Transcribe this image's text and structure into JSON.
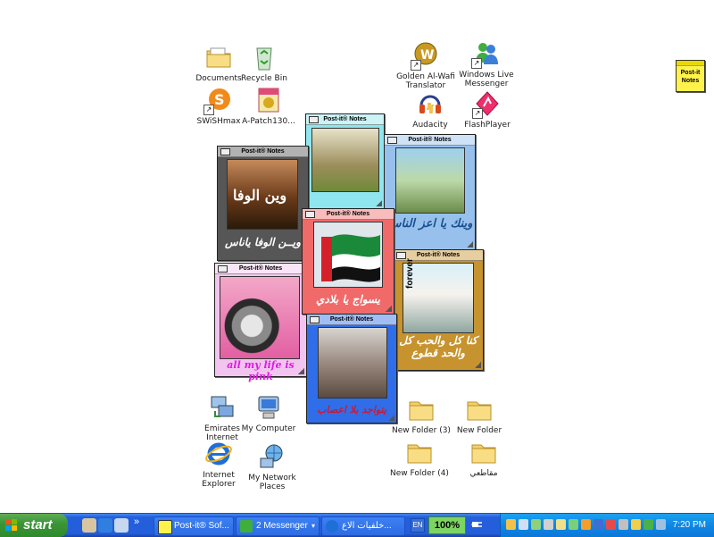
{
  "desktop_icons": [
    {
      "id": "documents",
      "label": "Documents",
      "icon": "folder-icon"
    },
    {
      "id": "recycle",
      "label": "Recycle Bin",
      "icon": "recycle-bin-icon"
    },
    {
      "id": "swish",
      "label": "SWiSHmax",
      "icon": "swish-icon"
    },
    {
      "id": "apatch",
      "label": "A-Patch130...",
      "icon": "patch-icon"
    },
    {
      "id": "golden",
      "label": "Golden Al-Wafi Translator",
      "icon": "translator-icon"
    },
    {
      "id": "wlm",
      "label": "Windows Live Messenger",
      "icon": "messenger-icon"
    },
    {
      "id": "audacity",
      "label": "Audacity",
      "icon": "audacity-icon"
    },
    {
      "id": "flash",
      "label": "FlashPlayer",
      "icon": "flash-icon"
    },
    {
      "id": "emirates",
      "label": "Emirates Internet",
      "icon": "network-computer-icon"
    },
    {
      "id": "mycomputer",
      "label": "My Computer",
      "icon": "computer-icon"
    },
    {
      "id": "ie",
      "label": "Internet Explorer",
      "icon": "ie-icon"
    },
    {
      "id": "network",
      "label": "My Network Places",
      "icon": "network-places-icon"
    },
    {
      "id": "nf3",
      "label": "New Folder (3)",
      "icon": "folder-icon"
    },
    {
      "id": "nf",
      "label": "New Folder",
      "icon": "folder-icon"
    },
    {
      "id": "nf4",
      "label": "New Folder (4)",
      "icon": "folder-icon"
    },
    {
      "id": "clips",
      "label": "مقاطعي",
      "icon": "folder-icon"
    }
  ],
  "sticky_widget": {
    "title": "Post-it Notes"
  },
  "notes": [
    {
      "id": "n1",
      "header": "Post-it® Notes",
      "caption": "ويــن  الوفا ياناس",
      "photo_text": "وين الوفا",
      "bg": "#565656",
      "capcolor": "#ffffff"
    },
    {
      "id": "n2",
      "header": "Post-it® Notes",
      "caption": "",
      "photo_text": "",
      "bg": "#8fe6ee",
      "capcolor": "#000000"
    },
    {
      "id": "n3",
      "header": "Post-it® Notes",
      "caption": "وينك يا اعز الناس",
      "photo_text": "",
      "bg": "#97c1ec",
      "capcolor": "#1a4f8f"
    },
    {
      "id": "n4",
      "header": "Post-it® Notes",
      "caption": "يسواج يا بلادي",
      "photo_text": "",
      "bg": "#f06a6a",
      "capcolor": "#ffffff"
    },
    {
      "id": "n5",
      "header": "Post-it® Notes",
      "caption": "كنا كل والحب كل والحد قطوع",
      "photo_text": "forever",
      "bg": "#c7932e",
      "capcolor": "#ffffff"
    },
    {
      "id": "n6",
      "header": "Post-it® Notes",
      "caption": "all my life is pink",
      "photo_text": "",
      "bg": "#f2c5f0",
      "capcolor": "#e01ae0"
    },
    {
      "id": "n7",
      "header": "Post-it® Notes",
      "caption": "يتواجد بلا اعصاب",
      "photo_text": "",
      "bg": "#2f6ee8",
      "capcolor": "#c81a3a"
    }
  ],
  "taskbar": {
    "start_label": "start",
    "quick_launch": [
      "show-desktop-icon",
      "ie-quick-icon",
      "media-icon",
      "more-chevron-icon"
    ],
    "tasks": [
      {
        "id": "postit",
        "label": "Post-it® Sof...",
        "icon": "postit-task-icon"
      },
      {
        "id": "messenger",
        "label": "2 Messenger",
        "icon": "messenger-task-icon"
      },
      {
        "id": "ie",
        "label": "خلفيات الاع...",
        "icon": "ie-task-icon"
      }
    ],
    "language": "EN",
    "zoom": "100%",
    "clock": "7:20 PM"
  },
  "colors": {
    "taskbar": "#245edb",
    "start": "#3c9639",
    "tray": "#0f87e4"
  }
}
